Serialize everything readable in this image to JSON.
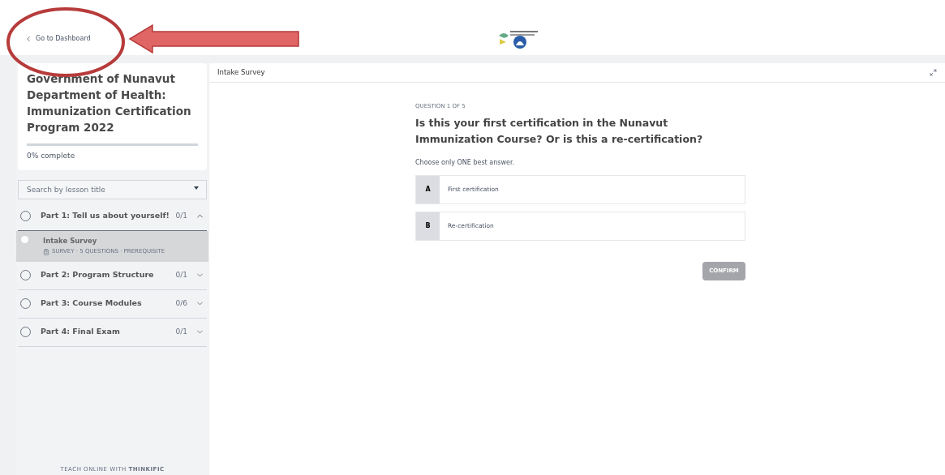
{
  "header": {
    "back_link": "Go to Dashboard"
  },
  "course": {
    "title": "Government of Nunavut Department of Health: Immunization Certification Program 2022",
    "level": 0,
    "progress_label": "0% complete"
  },
  "search": {
    "placeholder": "Search by lesson title"
  },
  "chapters": [
    {
      "title": "Part 1: Tell us about yourself!",
      "count": "0/1",
      "expanded": true,
      "lessons": [
        {
          "title": "Intake Survey",
          "meta": "SURVEY · 5 QUESTIONS · PREREQUISITE",
          "selected": true
        }
      ]
    },
    {
      "title": "Part 2: Program Structure",
      "count": "0/1",
      "expanded": false
    },
    {
      "title": "Part 3: Course Modules",
      "count": "0/6",
      "expanded": false
    },
    {
      "title": "Part 4: Final Exam",
      "count": "0/1",
      "expanded": false
    }
  ],
  "footer": "TEACH ONLINE WITH **THINKIFIC**",
  "content": {
    "title": "Intake Survey",
    "question_number": "QUESTION 1 OF 5",
    "question": "Is this your first certification in the Nunavut Immunization Course? Or is this a re-certification?",
    "instruction": "Choose only ONE best answer.",
    "answers": [
      {
        "letter": "A",
        "text": "First certification",
        "selected": false
      },
      {
        "letter": "B",
        "text": "Re-certification",
        "selected": false
      }
    ],
    "confirm": {
      "label": "CONFIRM",
      "disabled": true
    }
  }
}
